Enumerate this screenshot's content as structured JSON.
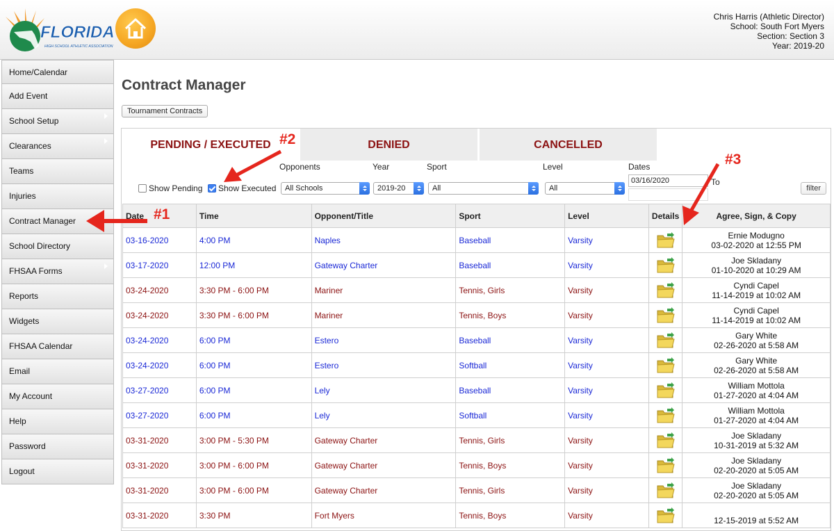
{
  "header": {
    "logo_text": "FLORIDA",
    "logo_subtext": "HIGH SCHOOL ATHLETIC ASSOCIATION",
    "user_lines": [
      "Chris Harris (Athletic Director)",
      "School: South Fort Myers",
      "Section: Section 3",
      "Year: 2019-20"
    ]
  },
  "sidebar": {
    "items": [
      {
        "label": "Home/Calendar",
        "submenu": false
      },
      {
        "label": "Add Event",
        "submenu": false
      },
      {
        "label": "School Setup",
        "submenu": true
      },
      {
        "label": "Clearances",
        "submenu": true
      },
      {
        "label": "Teams",
        "submenu": false
      },
      {
        "label": "Injuries",
        "submenu": false
      },
      {
        "label": "Contract Manager",
        "submenu": false
      },
      {
        "label": "School Directory",
        "submenu": false
      },
      {
        "label": "FHSAA Forms",
        "submenu": true
      },
      {
        "label": "Reports",
        "submenu": false
      },
      {
        "label": "Widgets",
        "submenu": false
      },
      {
        "label": "FHSAA Calendar",
        "submenu": false
      },
      {
        "label": "Email",
        "submenu": false
      },
      {
        "label": "My Account",
        "submenu": false
      },
      {
        "label": "Help",
        "submenu": false
      },
      {
        "label": "Password",
        "submenu": false
      },
      {
        "label": "Logout",
        "submenu": false
      }
    ]
  },
  "main": {
    "title": "Contract Manager",
    "tournament_button": "Tournament Contracts",
    "tabs": [
      "PENDING / EXECUTED",
      "DENIED",
      "CANCELLED"
    ],
    "filters": {
      "show_pending_label": "Show Pending",
      "show_pending_checked": false,
      "show_executed_label": "Show Executed",
      "show_executed_checked": true,
      "opponents_label": "Opponents",
      "opponents_value": "All Schools",
      "year_label": "Year",
      "year_value": "2019-20",
      "sport_label": "Sport",
      "sport_value": "All",
      "level_label": "Level",
      "level_value": "All",
      "dates_label": "Dates",
      "date_from": "03/16/2020",
      "to_label": "To",
      "filter_button": "filter"
    },
    "table": {
      "headers": [
        "Date",
        "Time",
        "Opponent/Title",
        "Sport",
        "Level",
        "Details",
        "Agree, Sign, & Copy"
      ],
      "rows": [
        {
          "status": "pending",
          "date": "03-16-2020",
          "time": "4:00 PM",
          "opponent": "Naples",
          "sport": "Baseball",
          "level": "Varsity",
          "signer": "Ernie Modugno",
          "signed": "03-02-2020 at 12:55 PM"
        },
        {
          "status": "pending",
          "date": "03-17-2020",
          "time": "12:00 PM",
          "opponent": "Gateway Charter",
          "sport": "Baseball",
          "level": "Varsity",
          "signer": "Joe Skladany",
          "signed": "01-10-2020 at 10:29 AM"
        },
        {
          "status": "executed",
          "date": "03-24-2020",
          "time": "3:30 PM - 6:00 PM",
          "opponent": "Mariner",
          "sport": "Tennis, Girls",
          "level": "Varsity",
          "signer": "Cyndi Capel",
          "signed": "11-14-2019 at 10:02 AM"
        },
        {
          "status": "executed",
          "date": "03-24-2020",
          "time": "3:30 PM - 6:00 PM",
          "opponent": "Mariner",
          "sport": "Tennis, Boys",
          "level": "Varsity",
          "signer": "Cyndi Capel",
          "signed": "11-14-2019 at 10:02 AM"
        },
        {
          "status": "pending",
          "date": "03-24-2020",
          "time": "6:00 PM",
          "opponent": "Estero",
          "sport": "Baseball",
          "level": "Varsity",
          "signer": "Gary White",
          "signed": "02-26-2020 at 5:58 AM"
        },
        {
          "status": "pending",
          "date": "03-24-2020",
          "time": "6:00 PM",
          "opponent": "Estero",
          "sport": "Softball",
          "level": "Varsity",
          "signer": "Gary White",
          "signed": "02-26-2020 at 5:58 AM"
        },
        {
          "status": "pending",
          "date": "03-27-2020",
          "time": "6:00 PM",
          "opponent": "Lely",
          "sport": "Baseball",
          "level": "Varsity",
          "signer": "William Mottola",
          "signed": "01-27-2020 at 4:04 AM"
        },
        {
          "status": "pending",
          "date": "03-27-2020",
          "time": "6:00 PM",
          "opponent": "Lely",
          "sport": "Softball",
          "level": "Varsity",
          "signer": "William Mottola",
          "signed": "01-27-2020 at 4:04 AM"
        },
        {
          "status": "executed",
          "date": "03-31-2020",
          "time": "3:00 PM - 5:30 PM",
          "opponent": "Gateway Charter",
          "sport": "Tennis, Girls",
          "level": "Varsity",
          "signer": "Joe Skladany",
          "signed": "10-31-2019 at 5:32 AM"
        },
        {
          "status": "executed",
          "date": "03-31-2020",
          "time": "3:00 PM - 6:00 PM",
          "opponent": "Gateway Charter",
          "sport": "Tennis, Boys",
          "level": "Varsity",
          "signer": "Joe Skladany",
          "signed": "02-20-2020 at 5:05 AM"
        },
        {
          "status": "executed",
          "date": "03-31-2020",
          "time": "3:00 PM - 6:00 PM",
          "opponent": "Gateway Charter",
          "sport": "Tennis, Girls",
          "level": "Varsity",
          "signer": "Joe Skladany",
          "signed": "02-20-2020 at 5:05 AM"
        },
        {
          "status": "executed",
          "date": "03-31-2020",
          "time": "3:30 PM",
          "opponent": "Fort Myers",
          "sport": "Tennis, Boys",
          "level": "Varsity",
          "signer": "",
          "signed": "12-15-2019 at 5:52 AM"
        }
      ]
    }
  },
  "annotations": [
    "#1",
    "#2",
    "#3"
  ],
  "colors": {
    "pending_link": "#1a28d6",
    "executed_link": "#8b1111",
    "tab_text": "#8b1111",
    "annotation": "#e5261d",
    "home_button": "#f5a623"
  }
}
